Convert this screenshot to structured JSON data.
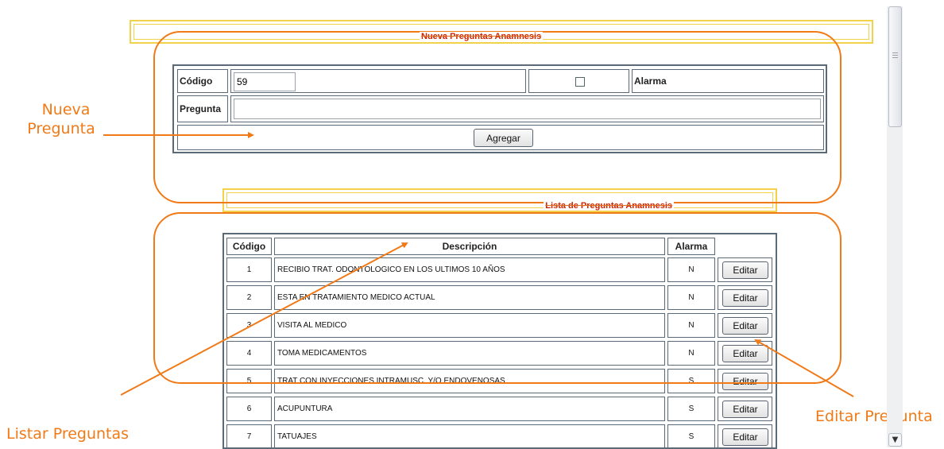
{
  "nueva_section": {
    "title": "Nueva Preguntas Anamnesis",
    "codigo_label": "Código",
    "codigo_value": "59",
    "alarma_label": "Alarma",
    "alarma_checked": false,
    "pregunta_label": "Pregunta",
    "pregunta_value": "",
    "agregar_label": "Agregar"
  },
  "lista_section": {
    "title": "Lista de Preguntas Anamnesis",
    "headers": {
      "codigo": "Código",
      "descripcion": "Descripción",
      "alarma": "Alarma"
    },
    "edit_label": "Editar",
    "rows": [
      {
        "codigo": "1",
        "descripcion": "RECIBIO TRAT. ODONTOLOGICO EN LOS ULTIMOS 10 AÑOS",
        "alarma": "N"
      },
      {
        "codigo": "2",
        "descripcion": "ESTA EN TRATAMIENTO MEDICO ACTUAL",
        "alarma": "N"
      },
      {
        "codigo": "3",
        "descripcion": "VISITA AL MEDICO",
        "alarma": "N"
      },
      {
        "codigo": "4",
        "descripcion": "TOMA MEDICAMENTOS",
        "alarma": "N"
      },
      {
        "codigo": "5",
        "descripcion": "TRAT CON INYECCIONES INTRAMUSC. Y/O ENDOVENOSAS",
        "alarma": "S"
      },
      {
        "codigo": "6",
        "descripcion": "ACUPUNTURA",
        "alarma": "S"
      },
      {
        "codigo": "7",
        "descripcion": "TATUAJES",
        "alarma": "S"
      }
    ]
  },
  "annotations": {
    "nueva_pregunta_line1": "Nueva",
    "nueva_pregunta_line2": "Pregunta",
    "listar_preguntas": "Listar Preguntas",
    "editar_pregunta": "Editar Pregunta"
  },
  "colors": {
    "annotation": "#f07a18",
    "title_text": "#cc2200",
    "title_border": "#f2d24a",
    "table_border": "#5a6a78"
  }
}
